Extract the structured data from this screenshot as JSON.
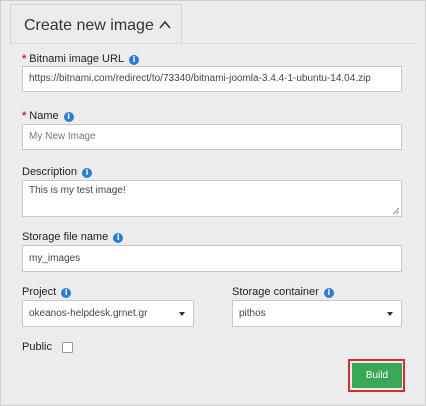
{
  "panel": {
    "tab_title": "Create new image"
  },
  "form": {
    "url": {
      "label": "Bitnami image URL",
      "value": "https://bitnami.com/redirect/to/73340/bitnami-joomla-3.4.4-1-ubuntu-14.04.zip",
      "required": true
    },
    "name": {
      "label": "Name",
      "placeholder": "My New Image",
      "required": true
    },
    "description": {
      "label": "Description",
      "value": "This is my test image!"
    },
    "storage_file": {
      "label": "Storage file name",
      "value": "my_images"
    },
    "project": {
      "label": "Project",
      "selected": "okeanos-helpdesk.grnet.gr"
    },
    "container": {
      "label": "Storage container",
      "selected": "pithos"
    },
    "public": {
      "label": "Public",
      "checked": false
    },
    "build_label": "Build"
  },
  "colors": {
    "accent_info": "#2b7cd3",
    "build_button": "#3aa757",
    "highlight_outline": "#d32f2f",
    "required_marker": "#c62828"
  },
  "icons": {
    "tab_toggle": "chevron-up-icon",
    "field_help": "info-icon",
    "select": "caret-down-icon"
  }
}
